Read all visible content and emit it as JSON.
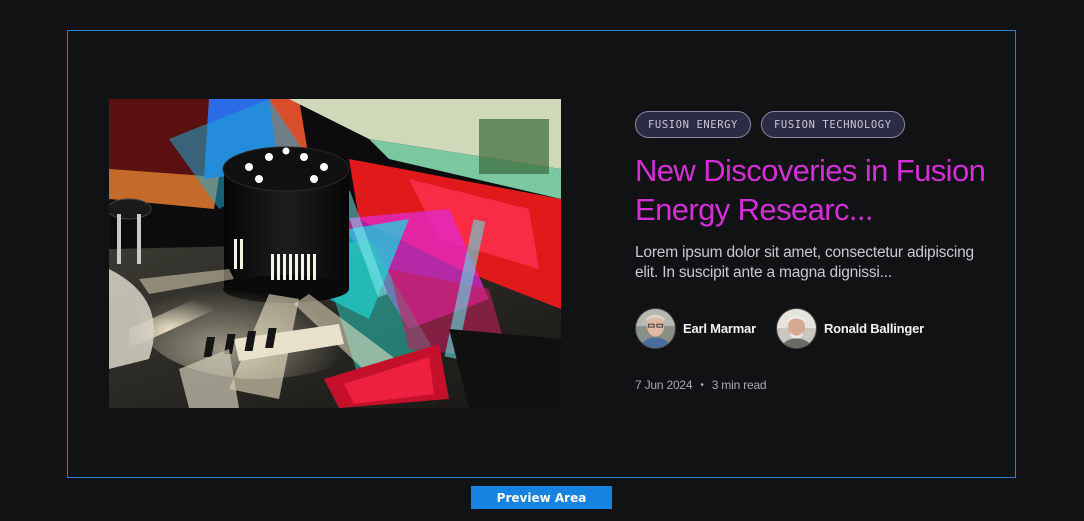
{
  "card": {
    "tags": [
      "FUSION ENERGY",
      "FUSION TECHNOLOGY"
    ],
    "title": "New Discoveries in Fusion Energy Researc...",
    "excerpt": "Lorem ipsum dolor sit amet, consectetur adipiscing elit. In suscipit ante a magna dignissi...",
    "authors": [
      {
        "name": "Earl Marmar"
      },
      {
        "name": "Ronald Ballinger"
      }
    ],
    "date": "7 Jun 2024",
    "separator": "•",
    "read_time": "3 min read"
  },
  "preview": {
    "label": "Preview Area"
  },
  "colors": {
    "background": "#111213",
    "frame_border": "#2f7fd6",
    "title": "#d42fd6",
    "tag_bg": "#2b2b44",
    "preview_label_bg": "#1683e3"
  }
}
